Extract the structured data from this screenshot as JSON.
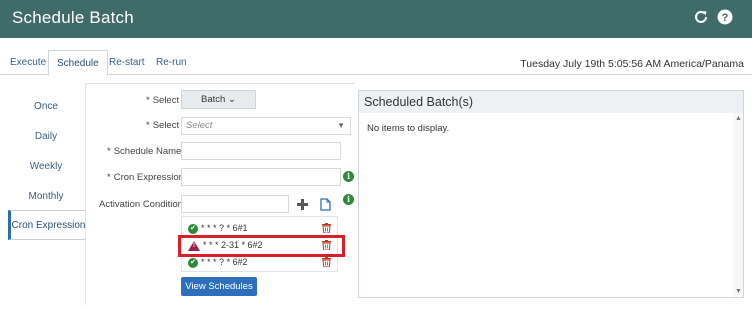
{
  "header": {
    "title": "Schedule Batch",
    "icons": [
      "refresh-icon",
      "help-icon"
    ]
  },
  "tabs": [
    {
      "label": "Execute",
      "active": false
    },
    {
      "label": "Schedule",
      "active": true
    },
    {
      "label": "Re-start",
      "active": false
    },
    {
      "label": "Re-run",
      "active": false
    }
  ],
  "datetime": "Tuesday July 19th 5:05:56 AM America/Panama",
  "sidenav": [
    {
      "label": "Once"
    },
    {
      "label": "Daily"
    },
    {
      "label": "Weekly"
    },
    {
      "label": "Monthly"
    },
    {
      "label": "Cron Expression",
      "active": true
    }
  ],
  "form": {
    "select1_label": "Select",
    "select1_value": "Batch",
    "select2_label": "Select",
    "select2_placeholder": "Select",
    "schedule_name_label": "Schedule Name:",
    "cron_label": "Cron Expression",
    "activation_label": "Activation Condition",
    "required_mark": "*"
  },
  "conditions": [
    {
      "text": "* * * ? * 6#1",
      "status": "ok"
    },
    {
      "text": "* * * 2-31 * 6#2",
      "status": "warning",
      "highlighted": true
    },
    {
      "text": "* * * ? * 6#2",
      "status": "ok"
    }
  ],
  "view_button": "View Schedules",
  "scheduled": {
    "title": "Scheduled Batch(s)",
    "empty_text": "No items to display."
  },
  "colors": {
    "header_bg": "#3f6b68",
    "primary": "#2d6fba",
    "ok": "#2d8a3a",
    "warning": "#a0204a",
    "highlight": "#d81f2a"
  }
}
